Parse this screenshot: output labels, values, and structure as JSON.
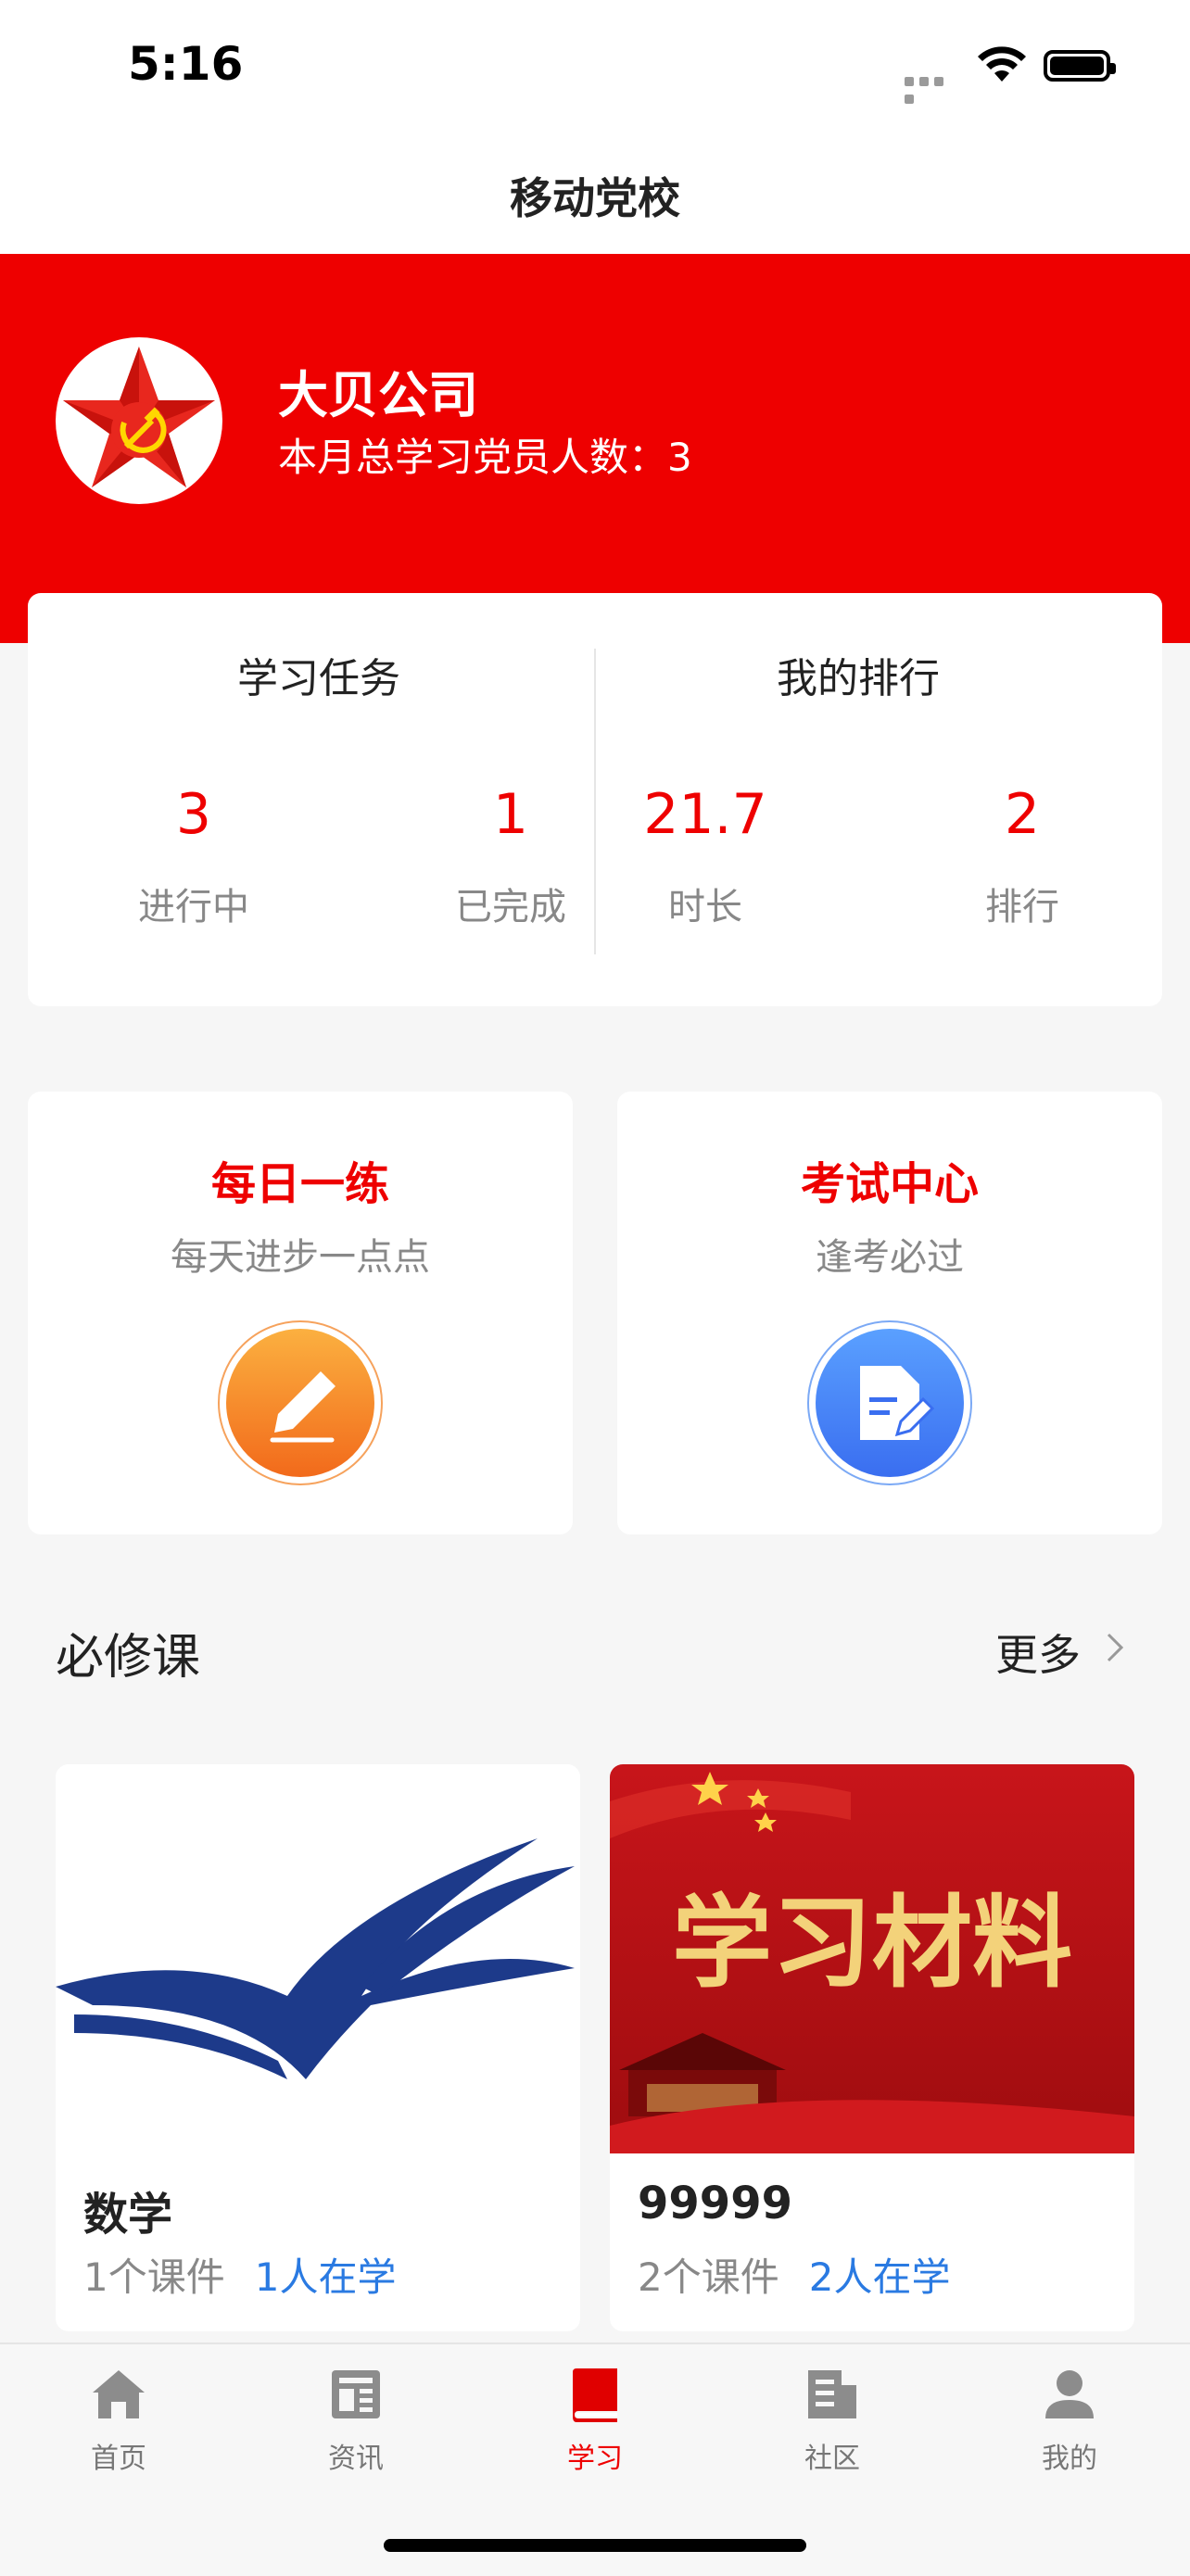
{
  "status": {
    "time": "5:16"
  },
  "nav": {
    "title": "移动党校"
  },
  "org": {
    "name": "大贝公司",
    "monthly_stat": "本月总学习党员人数：3"
  },
  "tasks": {
    "heading": "学习任务",
    "in_progress_value": "3",
    "in_progress_label": "进行中",
    "done_value": "1",
    "done_label": "已完成"
  },
  "ranking": {
    "heading": "我的排行",
    "duration_value": "21.7",
    "duration_label": "时长",
    "rank_value": "2",
    "rank_label": "排行"
  },
  "features": [
    {
      "title": "每日一练",
      "subtitle": "每天进步一点点",
      "icon": "pencil-icon",
      "color": "#f7841f"
    },
    {
      "title": "考试中心",
      "subtitle": "逢考必过",
      "icon": "document-edit-icon",
      "color": "#3d7cf0"
    }
  ],
  "required": {
    "title": "必修课",
    "more": "更多",
    "courses": [
      {
        "title": "数学",
        "lessons": "1个课件",
        "learners": "1人在学"
      },
      {
        "title": "99999",
        "lessons": "2个课件",
        "learners": "2人在学",
        "banner_text": "学习材料"
      }
    ]
  },
  "tabs": [
    {
      "label": "首页",
      "icon": "home-icon"
    },
    {
      "label": "资讯",
      "icon": "news-icon"
    },
    {
      "label": "学习",
      "icon": "book-icon",
      "active": true
    },
    {
      "label": "社区",
      "icon": "community-icon"
    },
    {
      "label": "我的",
      "icon": "profile-icon"
    }
  ],
  "colors": {
    "brand_red": "#ee0000",
    "accent_red": "#e00000",
    "link_blue": "#2a7ae2"
  }
}
